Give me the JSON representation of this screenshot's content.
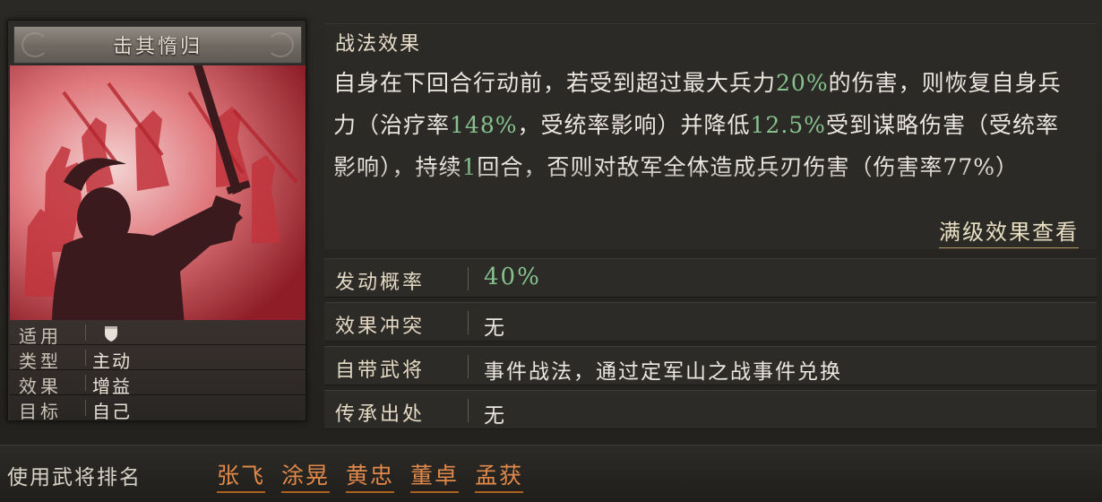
{
  "skill": {
    "name": "击其惰归",
    "stats": [
      {
        "label": "适用",
        "value": "",
        "icon": "shield-icon"
      },
      {
        "label": "类型",
        "value": "主动"
      },
      {
        "label": "效果",
        "value": "增益"
      },
      {
        "label": "目标",
        "value": "自己"
      }
    ]
  },
  "effect": {
    "heading": "战法效果",
    "segments": [
      {
        "t": "自身在下回合行动前，若受到超过最大兵力"
      },
      {
        "t": "20%",
        "green": true
      },
      {
        "t": "的伤害，"
      },
      {
        "t": "则恢复自身兵力（治疗率"
      },
      {
        "t": "148%",
        "green": true
      },
      {
        "t": "，受统率影响）并降低"
      },
      {
        "t": "12.5%",
        "green": true
      },
      {
        "t": "受到谋略伤害（受统率影响），持续"
      },
      {
        "t": "1",
        "green": true
      },
      {
        "t": "回合，否则对"
      },
      {
        "t": "敌军全体造成兵刃伤害（伤害率77%）"
      }
    ],
    "detail_link": "满级效果查看"
  },
  "info": [
    {
      "label": "发动概率",
      "value": "40%",
      "green": true
    },
    {
      "label": "效果冲突",
      "value": "无"
    },
    {
      "label": "自带武将",
      "value": "事件战法，通过定军山之战事件兑换"
    },
    {
      "label": "传承出处",
      "value": "无"
    }
  ],
  "ranking": {
    "label": "使用武将排名",
    "names": [
      "张飞",
      "涂晃",
      "黄忠",
      "董卓",
      "孟获"
    ]
  },
  "colors": {
    "highlight_green": "#86c28e",
    "rank_orange": "#e0894a",
    "art_red": "#c2343c"
  }
}
